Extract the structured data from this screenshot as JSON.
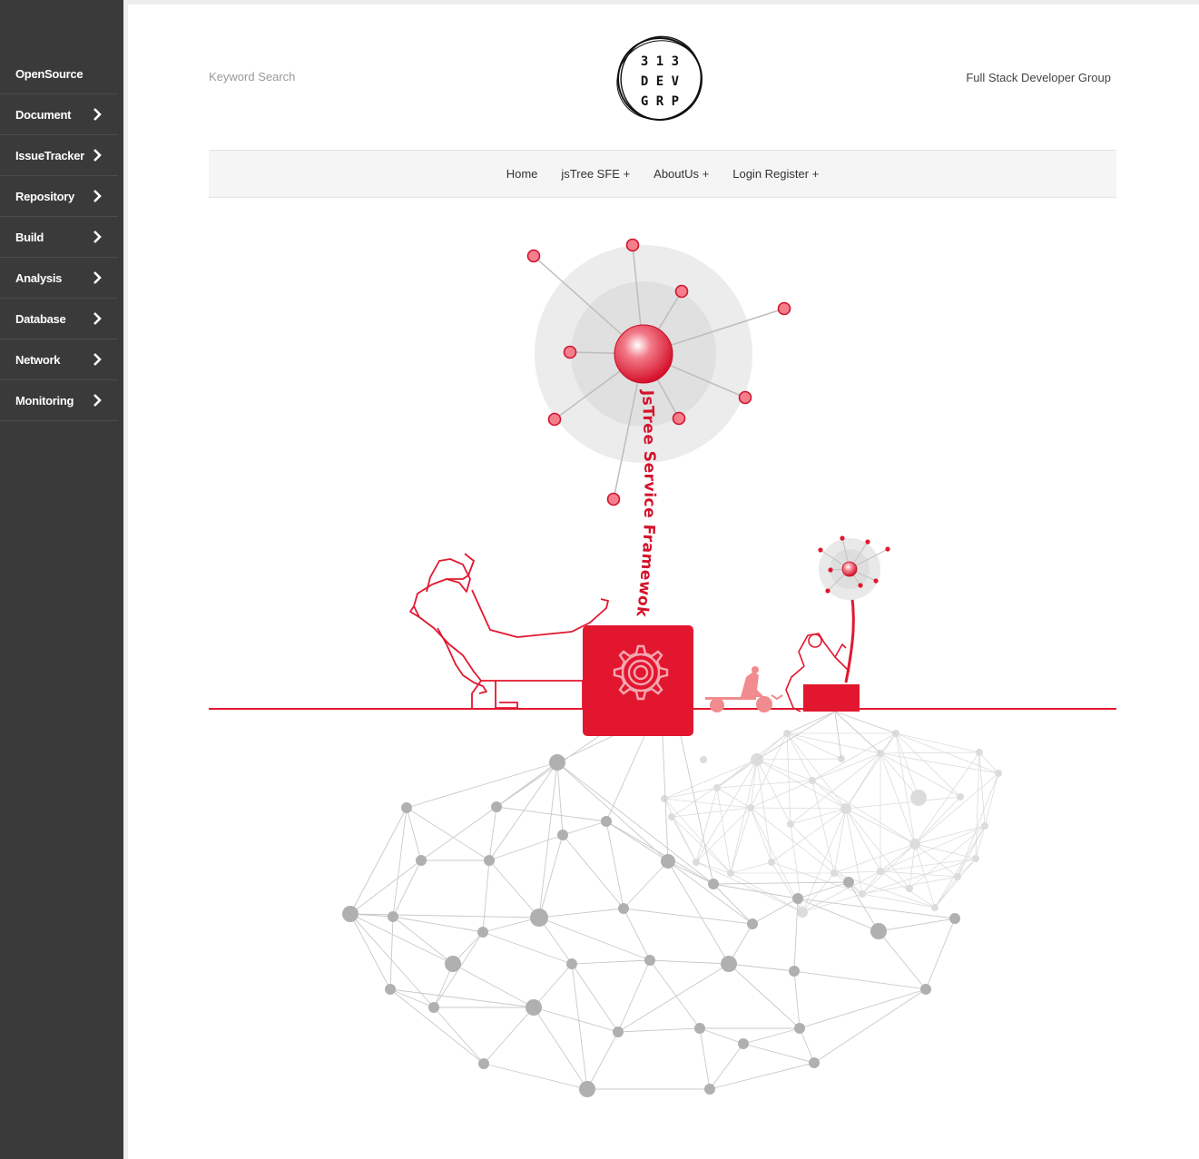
{
  "sidebar": {
    "items": [
      {
        "label": "OpenSource",
        "has_arrow": false
      },
      {
        "label": "Document",
        "has_arrow": true
      },
      {
        "label": "IssueTracker",
        "has_arrow": true
      },
      {
        "label": "Repository",
        "has_arrow": true
      },
      {
        "label": "Build",
        "has_arrow": true
      },
      {
        "label": "Analysis",
        "has_arrow": true
      },
      {
        "label": "Database",
        "has_arrow": true
      },
      {
        "label": "Network",
        "has_arrow": true
      },
      {
        "label": "Monitoring",
        "has_arrow": true
      }
    ]
  },
  "header": {
    "search_placeholder": "Keyword Search",
    "tagline": "Full Stack Developer Group",
    "logo": {
      "row1": "3 1 3",
      "row2": "D E V",
      "row3": "G R P"
    }
  },
  "nav": {
    "home": "Home",
    "jstree": "jsTree SFE +",
    "about": "AboutUs +",
    "login": "Login Register +"
  },
  "hero": {
    "curved_text": "JsTree Service Framewok",
    "accent_color": "#e2172f",
    "network_color": "#b5b5b5"
  }
}
